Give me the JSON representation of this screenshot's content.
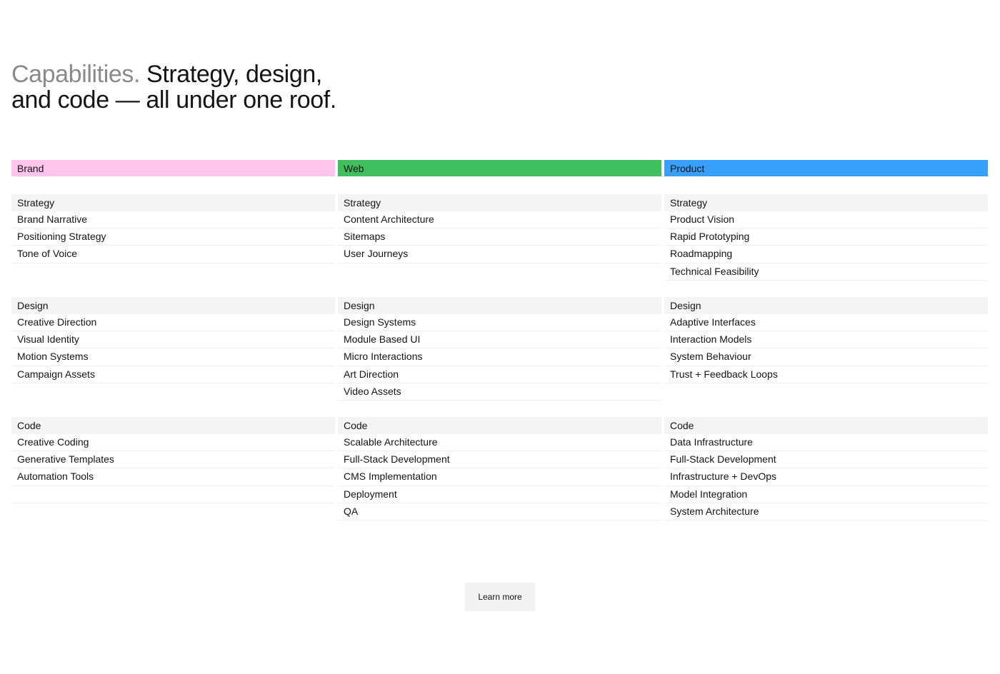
{
  "headline": {
    "muted": "Capabilities.",
    "line1": " Strategy, design,",
    "line2": "and code — all under one roof."
  },
  "colors": {
    "brand": "#ffc4ec",
    "web": "#40bf5e",
    "product": "#36a0fa"
  },
  "columns": [
    {
      "title": "Brand",
      "groups": [
        {
          "label": "Strategy",
          "items": [
            "Brand Narrative",
            "Positioning Strategy",
            "Tone of Voice"
          ]
        },
        {
          "label": "Design",
          "items": [
            "Creative Direction",
            "Visual Identity",
            "Motion Systems",
            "Campaign Assets"
          ]
        },
        {
          "label": "Code",
          "items": [
            "Creative Coding",
            "Generative Templates",
            "Automation Tools"
          ]
        }
      ]
    },
    {
      "title": "Web",
      "groups": [
        {
          "label": "Strategy",
          "items": [
            "Content Architecture",
            "Sitemaps",
            "User Journeys"
          ]
        },
        {
          "label": "Design",
          "items": [
            "Design Systems",
            "Module Based UI",
            "Micro Interactions",
            "Art Direction",
            "Video Assets"
          ]
        },
        {
          "label": "Code",
          "items": [
            "Scalable Architecture",
            "Full-Stack Development",
            "CMS Implementation",
            "Deployment",
            "QA"
          ]
        }
      ]
    },
    {
      "title": "Product",
      "groups": [
        {
          "label": "Strategy",
          "items": [
            "Product Vision",
            "Rapid Prototyping",
            "Roadmapping",
            "Technical Feasibility"
          ]
        },
        {
          "label": "Design",
          "items": [
            "Adaptive Interfaces",
            "Interaction Models",
            "System Behaviour",
            "Trust + Feedback Loops"
          ]
        },
        {
          "label": "Code",
          "items": [
            "Data Infrastructure",
            "Full-Stack Development",
            "Infrastructure + DevOps",
            "Model Integration",
            "System Architecture"
          ]
        }
      ]
    }
  ],
  "cta": {
    "label": "Learn more"
  }
}
